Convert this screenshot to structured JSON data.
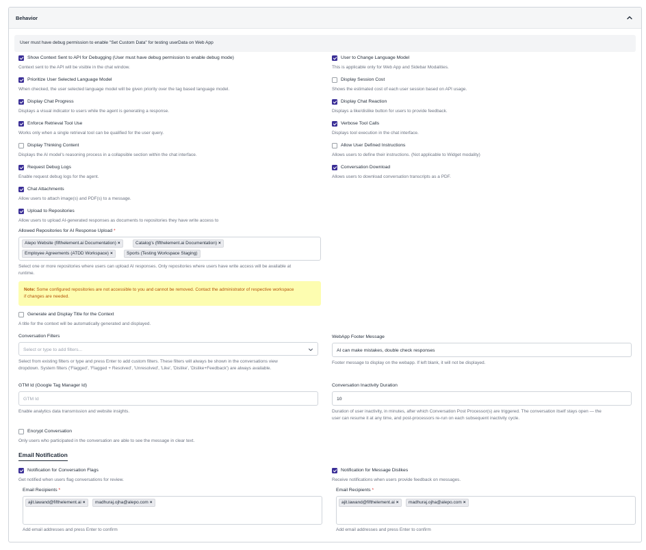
{
  "section": {
    "title": "Behavior"
  },
  "banner": {
    "text": "User must have debug permission to enable \"Set Custom Data\" for testing userData on Web App"
  },
  "options_left": [
    {
      "label": "Show Context Sent to API for Debugging (User must have debug permission to enable debug mode)",
      "desc": "Context sent to the API will be visible in the chat window.",
      "checked": true
    },
    {
      "label": "Prioritize User Selected Language Model",
      "desc": "When checked, the user selected language model will be given priority over the tag based language model.",
      "checked": true
    },
    {
      "label": "Display Chat Progress",
      "desc": "Displays a visual indicator to users while the agent is generating a response.",
      "checked": true
    },
    {
      "label": "Enforce Retrieval Tool Use",
      "desc": "Works only when a single retrieval tool can be qualified for the user query.",
      "checked": true
    },
    {
      "label": "Display Thinking Content",
      "desc": "Displays the AI model's reasoning process in a collapsible section within the chat interface.",
      "checked": false
    },
    {
      "label": "Request Debug Logs",
      "desc": "Enable request debug logs for the agent.",
      "checked": true
    },
    {
      "label": "Chat Attachments",
      "desc": "Allow users to attach image(s) and PDF(s) to a message.",
      "checked": true
    },
    {
      "label": "Upload to Repositories",
      "desc": "Allow users to upload AI-generated responses as documents to repositories they have write access to",
      "checked": true
    }
  ],
  "options_right": [
    {
      "label": "User to Change Language Model",
      "desc": "This is applicable only for Web App and Sidebar Modalities.",
      "checked": true
    },
    {
      "label": "Display Session Cost",
      "desc": "Shows the estimated cost of each user session based on API usage.",
      "checked": false
    },
    {
      "label": "Display Chat Reaction",
      "desc": "Displays a like/dislike button for users to provide feedback.",
      "checked": true
    },
    {
      "label": "Verbose Tool Calls",
      "desc": "Displays tool execution in the chat interface.",
      "checked": true
    },
    {
      "label": "Allow User Defined Instructions",
      "desc": "Allows users to define their instructions. (Not applicable to Widget modality)",
      "checked": false
    },
    {
      "label": "Conversation Download",
      "desc": "Allows users to download conversation transcripts as a PDF.",
      "checked": true
    }
  ],
  "repositories": {
    "label": "Allowed Repositories for AI Response Upload",
    "required_mark": "*",
    "chips": [
      "Alepo Website (fifthelement.ai Documentation)",
      "Catalog's (fifthelement.ai Documentation)",
      "Employee Agreements (ATDD Workspace)",
      "Sports (Testing Workspace Staging)"
    ],
    "remove_glyph": "×",
    "help_line1": "Select one or more repositories where users can upload AI responses. Only repositories where users have write access will be available at",
    "help_line2": "runtime."
  },
  "note": {
    "prefix": "Note:",
    "line1": " Some configured repositories are not accessible to you and cannot be removed. Contact the administrator of respective workspace",
    "line2": "if changes are needed."
  },
  "generate_title": {
    "label": "Generate and Display Title for the Context",
    "desc": "A title for the context will be automatically generated and displayed.",
    "checked": false
  },
  "conversation_filters": {
    "label": "Conversation Filters",
    "placeholder": "Select or type to add filters...",
    "help_line1": "Select from existing filters or type and press Enter to add custom filters. These filters will always be shown in the conversations view",
    "help_line2": "dropdown. System filters ('Flagged', 'Flagged + Resolved', 'Unresolved', 'Like', 'Dislike', 'Dislike+Feedback') are always available."
  },
  "footer_message": {
    "label": "WebApp Footer Message",
    "value": "AI can make mistakes, double check responses",
    "help": "Footer message to display on the webapp. If left blank, it will not be displayed."
  },
  "gtm": {
    "label": "GTM Id (Google Tag Manager Id)",
    "placeholder": "GTM Id",
    "help": "Enable analytics data transmission and website insights."
  },
  "inactivity": {
    "label": "Conversation Inactivity Duration",
    "value": "10",
    "help_line1": "Duration of user inactivity, in minutes, after which Conversation Post Processor(s) are triggered. The conversation itself stays open — the",
    "help_line2": "user can resume it at any time, and post-processors re-run on each subsequent inactivity cycle."
  },
  "encrypt": {
    "label": "Encrypt Conversation",
    "desc": "Only users who participated in the conversation are able to see the message in clear text.",
    "checked": false
  },
  "email_section": {
    "title": "Email Notification"
  },
  "notify_flags": {
    "label": "Notification for Conversation Flags",
    "desc": "Get notified when users flag conversations for review.",
    "checked": true,
    "recipients_label": "Email Recipients",
    "required_mark": "*",
    "chips": [
      "ajit.lawand@fifthelement.ai",
      "madhuraj.ojha@alepo.com"
    ],
    "help": "Add email addresses and press Enter to confirm"
  },
  "notify_dislikes": {
    "label": "Notification for Message Dislikes",
    "desc": "Receive notifications when users provide feedback on messages.",
    "checked": true,
    "recipients_label": "Email Recipients",
    "required_mark": "*",
    "chips": [
      "ajit.lawand@fifthelement.ai",
      "madhuraj.ojha@alepo.com"
    ],
    "help": "Add email addresses and press Enter to confirm"
  },
  "colors": {
    "accent": "#3b2f97",
    "note_bg": "#fdfdb0",
    "note_text": "#b45309",
    "required": "#dc2626"
  }
}
